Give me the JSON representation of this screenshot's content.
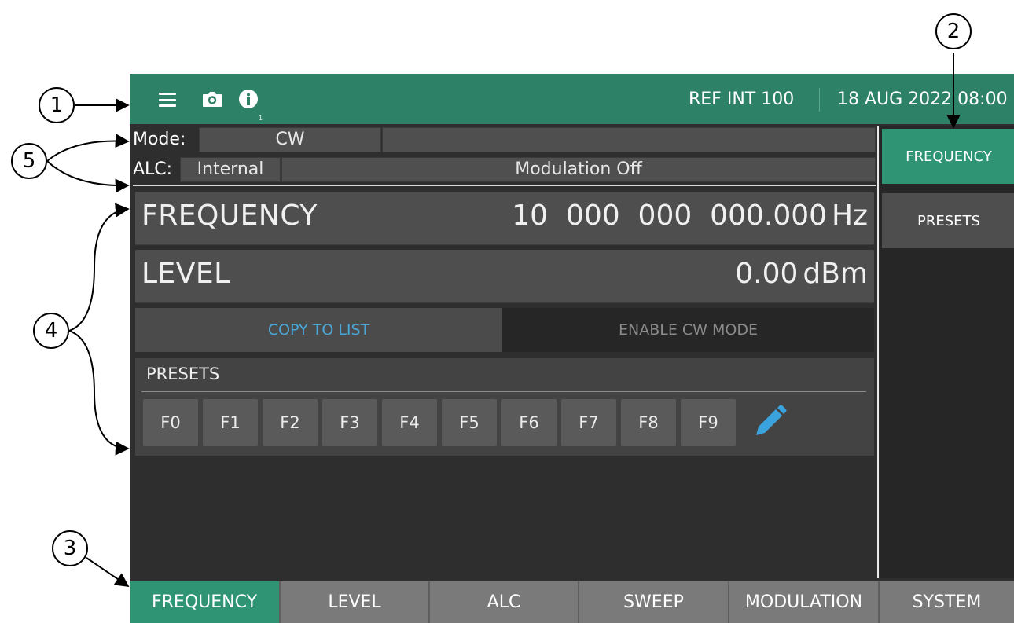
{
  "topbar": {
    "menu_icon": "menu-icon",
    "camera_icon": "camera-icon",
    "info_icon": "info-icon",
    "info_badge": "1",
    "ref": "REF INT 100",
    "datetime": "18 AUG 2022 08:00"
  },
  "status": {
    "mode_label": "Mode:",
    "mode_value": "CW",
    "alc_label": "ALC:",
    "alc_value": "Internal",
    "modulation": "Modulation Off"
  },
  "params": {
    "frequency_label": "FREQUENCY",
    "frequency_value": "10  000  000  000.000",
    "frequency_unit": "Hz",
    "level_label": "LEVEL",
    "level_value": "0.00",
    "level_unit": "dBm"
  },
  "actions": {
    "copy_to_list": "COPY TO LIST",
    "enable_cw": "ENABLE CW MODE"
  },
  "presets": {
    "title": "PRESETS",
    "keys": [
      "F0",
      "F1",
      "F2",
      "F3",
      "F4",
      "F5",
      "F6",
      "F7",
      "F8",
      "F9"
    ],
    "edit_icon": "pencil-icon"
  },
  "side_menu": {
    "frequency": "FREQUENCY",
    "presets": "PRESETS"
  },
  "bottom_tabs": [
    "FREQUENCY",
    "LEVEL",
    "ALC",
    "SWEEP",
    "MODULATION",
    "SYSTEM"
  ],
  "callouts": [
    "1",
    "2",
    "3",
    "4",
    "5"
  ],
  "colors": {
    "accent": "#2e9474",
    "topbar": "#2d8166",
    "link_blue": "#4aa8d8",
    "background": "#2e2e2e"
  }
}
